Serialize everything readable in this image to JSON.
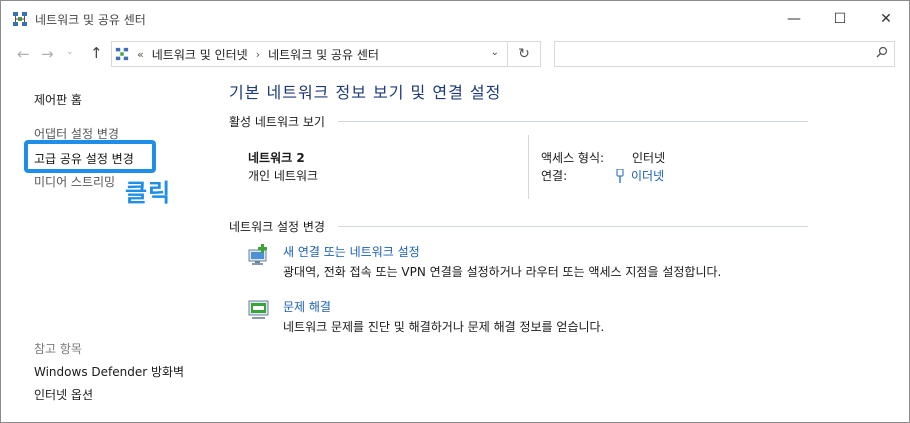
{
  "window": {
    "title": "네트워크 및 공유 센터",
    "minimize": "—",
    "maximize": "☐",
    "close": "✕"
  },
  "nav": {
    "back": "←",
    "forward": "→",
    "recent": "⌄",
    "up": "↑",
    "overflow": "«",
    "breadcrumbs": [
      "네트워크 및 인터넷",
      "네트워크 및 공유 센터"
    ],
    "separator": "›",
    "dropdown": "⌄",
    "refresh": "↻",
    "search_icon": "🔍"
  },
  "sidebar": {
    "home": "제어판 홈",
    "adapter": "어댑터 설정 변경",
    "advanced": "고급 공유 설정 변경",
    "media": "미디어 스트리밍",
    "annotation": "클릭",
    "see_also_heading": "참고 항목",
    "firewall": "Windows Defender 방화벽",
    "internet_options": "인터넷 옵션"
  },
  "main": {
    "title": "기본 네트워크 정보 보기 및 연결 설정",
    "active_networks_label": "활성 네트워크 보기",
    "network_name": "네트워크 2",
    "network_type": "개인 네트워크",
    "access_type_label": "액세스 형식:",
    "access_type_value": "인터넷",
    "connections_label": "연결:",
    "connections_value": "이더넷",
    "change_settings_label": "네트워크 설정 변경",
    "tasks": [
      {
        "link": "새 연결 또는 네트워크 설정",
        "desc": "광대역, 전화 접속 또는 VPN 연결을 설정하거나 라우터 또는 액세스 지점을 설정합니다."
      },
      {
        "link": "문제 해결",
        "desc": "네트워크 문제를 진단 및 해결하거나 문제 해결 정보를 얻습니다."
      }
    ]
  },
  "colors": {
    "accent": "#1e8ee6",
    "link": "#1a5fb4",
    "title": "#1e3a7b"
  }
}
